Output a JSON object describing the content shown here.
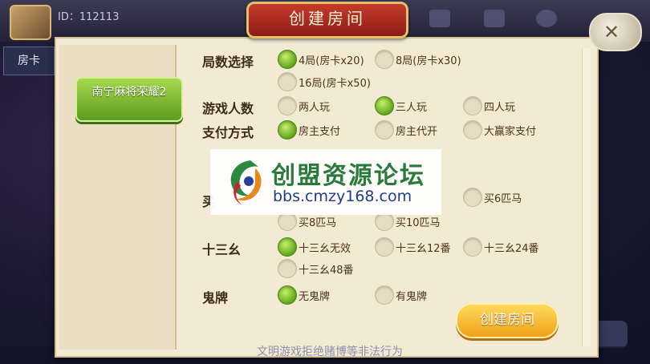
{
  "header": {
    "player_id": "ID：112113",
    "tab_room_card": "房卡"
  },
  "dialog": {
    "title": "创建房间",
    "game_button": "南宁麻将荣耀2",
    "sections": {
      "rounds": {
        "label": "局数选择",
        "options": [
          "4局(房卡x20)",
          "8局(房卡x30)",
          "16局(房卡x50)"
        ]
      },
      "players": {
        "label": "游戏人数",
        "options": [
          "两人玩",
          "三人玩",
          "四人玩"
        ]
      },
      "payment": {
        "label": "支付方式",
        "options": [
          "房主支付",
          "房主代开",
          "大赢家支付"
        ]
      },
      "horses": {
        "label": "买",
        "options": [
          "买6匹马",
          "买8匹马",
          "买10匹马"
        ]
      },
      "thirteen": {
        "label": "十三幺",
        "options": [
          "十三幺无效",
          "十三幺12番",
          "十三幺24番",
          "十三幺48番"
        ]
      },
      "ghost": {
        "label": "鬼牌",
        "options": [
          "无鬼牌",
          "有鬼牌"
        ]
      }
    },
    "create_button": "创建房间"
  },
  "footer_note": "文明游戏拒绝赌博等非法行为",
  "watermark": {
    "name": "创盟资源论坛",
    "url": "bbs.cmzy168.com"
  },
  "colors": {
    "selected_radio": "#62a61d",
    "panel_bg": "#f3ead4",
    "title_red": "#c63b2c",
    "create_button": "#f0a21a"
  }
}
